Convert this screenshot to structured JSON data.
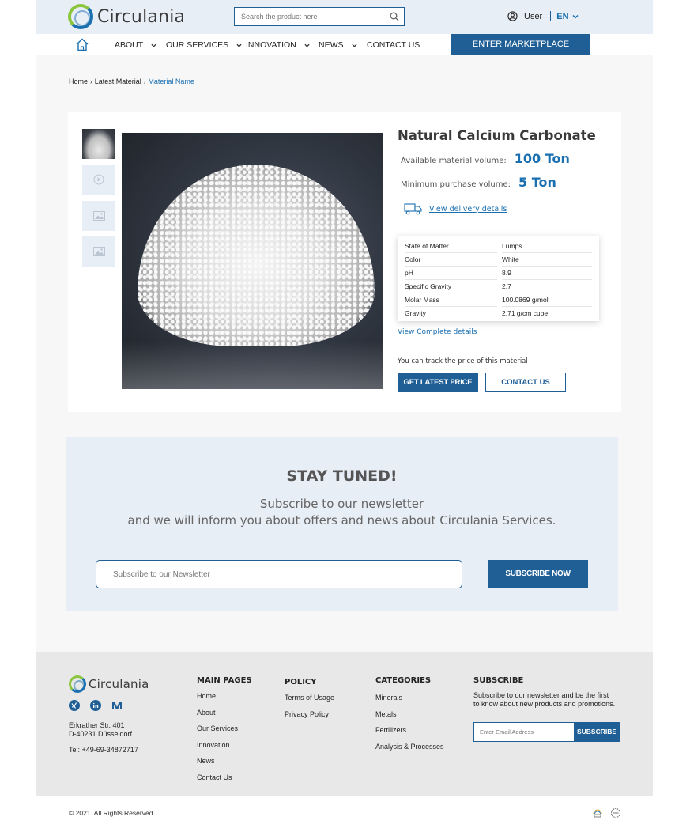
{
  "header": {
    "brand": "Circulania",
    "search_placeholder": "Search the product here",
    "user_label": "User",
    "lang_label": "EN"
  },
  "nav": {
    "items": [
      {
        "label": "ABOUT",
        "has_dropdown": true
      },
      {
        "label": "OUR SERVICES",
        "has_dropdown": true
      },
      {
        "label": "INNOVATION",
        "has_dropdown": true
      },
      {
        "label": "NEWS",
        "has_dropdown": true
      },
      {
        "label": "CONTACT US",
        "has_dropdown": false
      }
    ],
    "market_button": "ENTER MARKETPLACE"
  },
  "breadcrumb": {
    "items": [
      "Home",
      "Latest Material"
    ],
    "current": "Material Name"
  },
  "product": {
    "title": "Natural Calcium Carbonate",
    "available_label": "Available material volume:",
    "available_value": "100 Ton",
    "minimum_label": "Minimum purchase volume:",
    "minimum_value": "5 Ton",
    "delivery_link": "View delivery details",
    "specs": [
      {
        "key": "State of Matter",
        "value": "Lumps"
      },
      {
        "key": "Color",
        "value": "White"
      },
      {
        "key": "pH",
        "value": "8.9"
      },
      {
        "key": "Specific Gravity",
        "value": "2.7"
      },
      {
        "key": "Molar Mass",
        "value": "100.0869 g/mol"
      },
      {
        "key": "Gravity",
        "value": "2.71 g/cm cube"
      }
    ],
    "complete_link": "View Complete details",
    "track_text": "You can track the price of this material",
    "price_button": "GET LATEST PRICE",
    "contact_button": "CONTACT US"
  },
  "newsletter": {
    "title": "STAY TUNED!",
    "subtitle_line1": "Subscribe to our newsletter",
    "subtitle_line2": "and we will inform you about offers and news about Circulania Services.",
    "input_placeholder": "Subscribe to our Newsletter",
    "button": "SUBSCRIBE NOW"
  },
  "footer": {
    "brand": "Circulania",
    "address_line1": "Erkrather Str. 401",
    "address_line2": "D-40231 Düsseldorf",
    "tel": "Tel: +49-69-34872717",
    "main_pages": {
      "title": "MAIN PAGES",
      "links": [
        "Home",
        "About",
        "Our Services",
        "Innovation",
        "News",
        "Contact Us"
      ]
    },
    "policy": {
      "title": "POLICY",
      "links": [
        "Terms of Usage",
        "Privacy Policy"
      ]
    },
    "categories": {
      "title": "CATEGORIES",
      "links": [
        "Minerals",
        "Metals",
        "Fertilizers",
        "Analysis & Processes"
      ]
    },
    "subscribe": {
      "title": "SUBSCRIBE",
      "text": "Subscribe to our newsletter and be the first to know about new products and promotions.",
      "input_placeholder": "Enter Email Address",
      "button": "SUBSCRIBE"
    },
    "copyright": "© 2021. All Rights Reserved."
  }
}
